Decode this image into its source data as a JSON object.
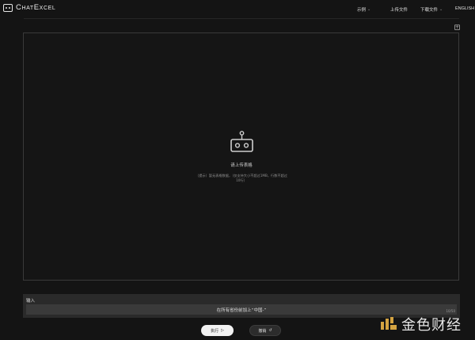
{
  "app": {
    "name": "ChatExcel"
  },
  "nav": {
    "examples": "示例",
    "upload": "上传文件",
    "download": "下载文件",
    "language": "ENGLISH"
  },
  "empty_state": {
    "title": "请上传表格",
    "hint_line1": "（提示）暂无表格数据，（仅支持大小不超过1MB，行数不超过",
    "hint_line2": "10行）"
  },
  "input": {
    "label": "输入",
    "value": "在所有省份前加上“中国-”",
    "counter": "10/50"
  },
  "buttons": {
    "run": "执行",
    "undo": "撤销"
  },
  "watermark": {
    "text": "金色财经"
  }
}
